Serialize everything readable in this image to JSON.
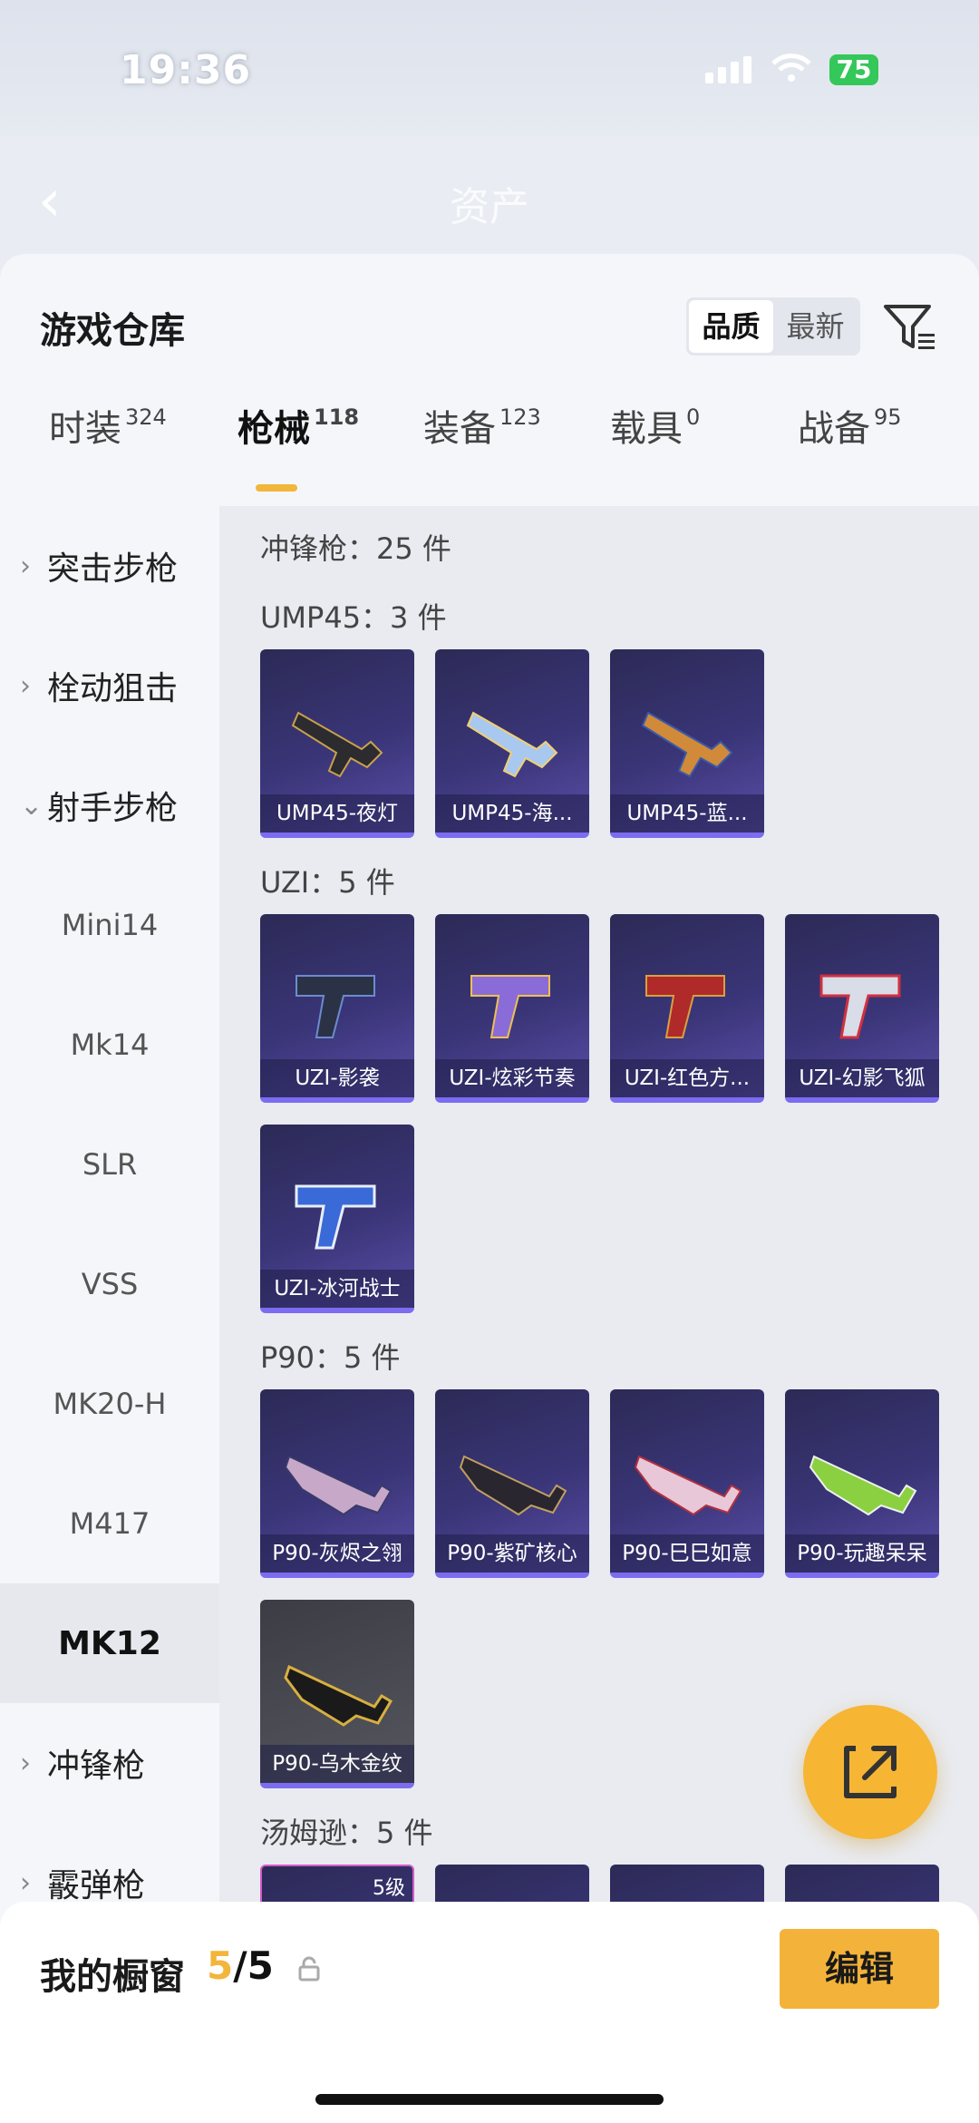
{
  "status": {
    "time": "19:36",
    "battery": "75"
  },
  "nav": {
    "title": "资产"
  },
  "header": {
    "title": "游戏仓库",
    "sort_options": [
      "品质",
      "最新"
    ],
    "sort_active": "品质"
  },
  "tabs": [
    {
      "label": "时装",
      "count": "324"
    },
    {
      "label": "枪械",
      "count": "118",
      "active": true
    },
    {
      "label": "装备",
      "count": "123"
    },
    {
      "label": "载具",
      "count": "0"
    },
    {
      "label": "战备",
      "count": "95"
    }
  ],
  "sidebar": [
    {
      "label": "突击步枪",
      "type": "group",
      "icon": "chevron-right"
    },
    {
      "label": "栓动狙击",
      "type": "group",
      "icon": "chevron-right"
    },
    {
      "label": "射手步枪",
      "type": "group",
      "icon": "chevron-down"
    },
    {
      "label": "Mini14",
      "type": "sub"
    },
    {
      "label": "Mk14",
      "type": "sub"
    },
    {
      "label": "SLR",
      "type": "sub"
    },
    {
      "label": "VSS",
      "type": "sub"
    },
    {
      "label": "MK20-H",
      "type": "sub"
    },
    {
      "label": "M417",
      "type": "sub"
    },
    {
      "label": "MK12",
      "type": "sub",
      "selected": true
    },
    {
      "label": "冲锋枪",
      "type": "group",
      "icon": "chevron-right"
    },
    {
      "label": "霰弹枪",
      "type": "group",
      "icon": "chevron-right"
    }
  ],
  "content": {
    "category_title": "冲锋枪：25 件",
    "groups": [
      {
        "title": "UMP45：3 件",
        "items": [
          "UMP45-夜灯",
          "UMP45-海...",
          "UMP45-蓝..."
        ]
      },
      {
        "title": "UZI：5 件",
        "items": [
          "UZI-影袭",
          "UZI-炫彩节奏",
          "UZI-红色方...",
          "UZI-幻影飞狐",
          "UZI-冰河战士"
        ]
      },
      {
        "title": "P90：5 件",
        "items": [
          "P90-灰烬之翎",
          "P90-紫矿核心",
          "P90-巳巳如意",
          "P90-玩趣呆呆",
          "P90-乌木金纹"
        ]
      },
      {
        "title": "汤姆逊：5 件",
        "items": [],
        "first_badge": "5级"
      }
    ]
  },
  "bottom": {
    "title": "我的橱窗",
    "count_current": "5",
    "count_total": "/5",
    "edit_label": "编辑"
  },
  "colors": {
    "accent": "#f2b63a",
    "card_bg": "#3a3578",
    "card_border": "#7b6cf0"
  }
}
